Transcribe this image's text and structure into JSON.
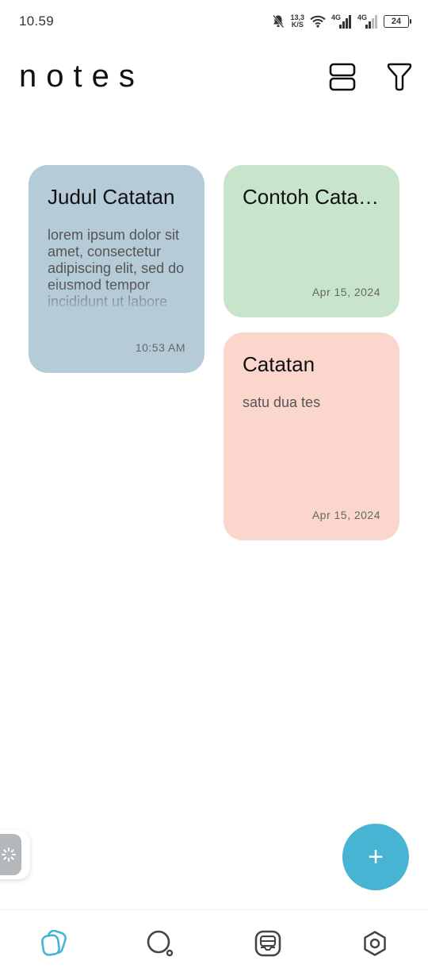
{
  "status_bar": {
    "time": "10.59",
    "speed_value": "13,3",
    "speed_unit": "K/S",
    "network_1": "4G",
    "network_2": "4G",
    "battery": "24",
    "icons": [
      "bell-muted-icon",
      "wifi-icon",
      "signal-icon",
      "signal-icon",
      "battery-icon"
    ]
  },
  "header": {
    "title": "notes",
    "icons": [
      "layout-toggle-icon",
      "filter-icon"
    ]
  },
  "notes": [
    {
      "title": "Judul Catatan",
      "body": "lorem ipsum dolor sit amet, consectetur adipiscing elit, sed do eiusmod tempor incididunt ut labore",
      "date": "10:53 AM",
      "color": "#b6cbd8"
    },
    {
      "title": "Contoh Catatan",
      "body": "",
      "date": "Apr 15, 2024",
      "color": "#c8e5cb"
    },
    {
      "title": "Catatan",
      "body": "satu dua tes",
      "date": "Apr 15, 2024",
      "color": "#fbd6cc"
    }
  ],
  "fab": {
    "label": "+",
    "color": "#48b4d3",
    "icon": "plus-icon"
  },
  "theme_toggle": {
    "icon": "sun-icon"
  },
  "bottom_nav": {
    "items": [
      {
        "name": "notes",
        "icon": "notes-icon",
        "active": true,
        "color": "#48b4d3"
      },
      {
        "name": "search",
        "icon": "search-icon",
        "active": false
      },
      {
        "name": "archive",
        "icon": "archive-icon",
        "active": false
      },
      {
        "name": "settings",
        "icon": "settings-icon",
        "active": false
      }
    ]
  }
}
